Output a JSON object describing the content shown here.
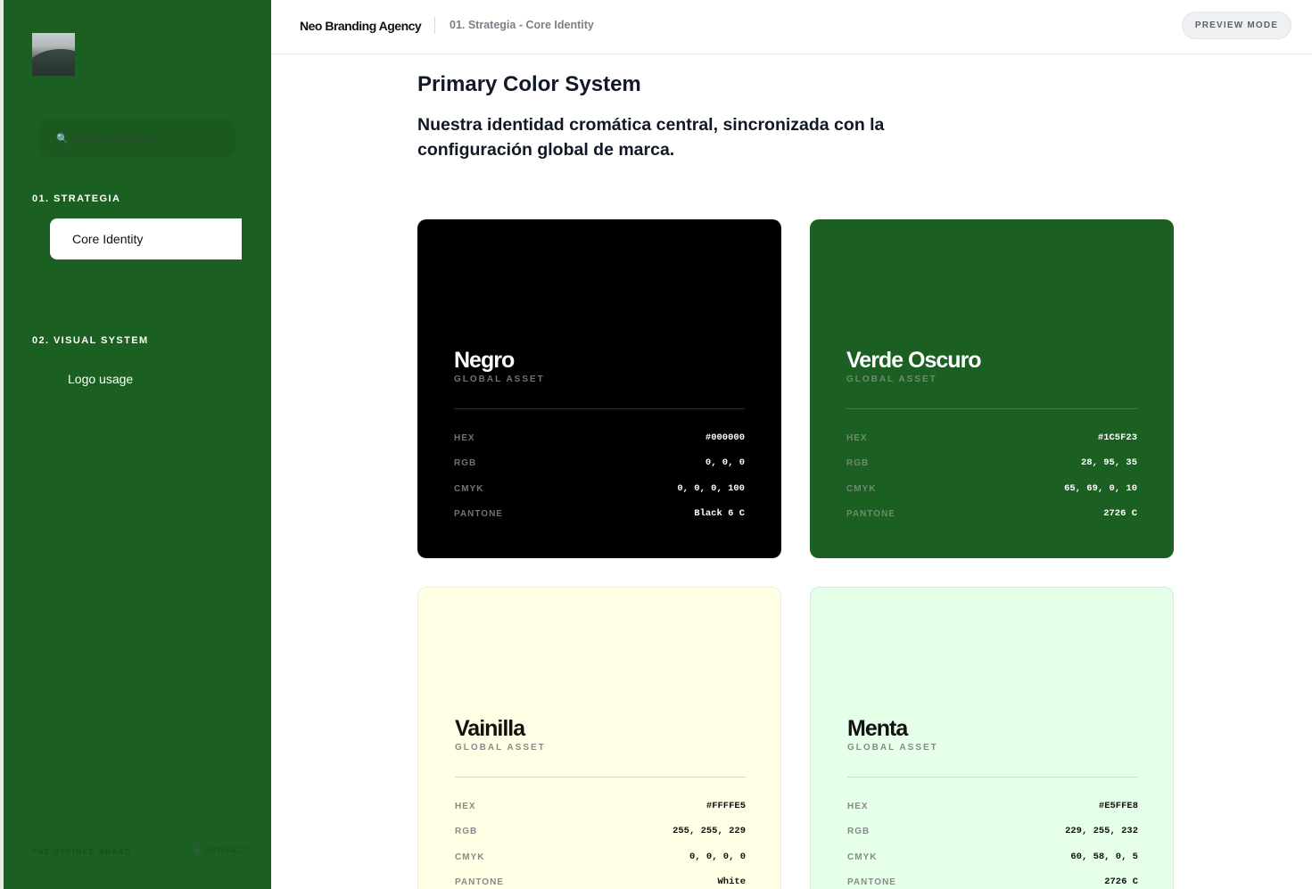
{
  "sidebar": {
    "search_placeholder": "Buscar sección...",
    "sections": [
      {
        "title": "01. STRATEGIA",
        "items": [
          "Core Identity"
        ]
      },
      {
        "title": "02. VISUAL SYSTEM",
        "items": [
          "Logo usage"
        ]
      }
    ],
    "footer_left": "THE DEFINED BRAND",
    "footer_right": "ARTEFACT"
  },
  "header": {
    "brand": "Neo Branding Agency",
    "breadcrumb": "01. Strategia - Core Identity",
    "preview_button": "PREVIEW MODE"
  },
  "main": {
    "title": "Primary Color System",
    "description": "Nuestra identidad cromática central, sincronizada con la configuración global de marca.",
    "labels": {
      "hex": "HEX",
      "rgb": "RGB",
      "cmyk": "CMYK",
      "pantone": "PANTONE",
      "asset": "GLOBAL ASSET"
    },
    "colors": [
      {
        "name": "Negro",
        "hex": "#000000",
        "rgb": "0, 0, 0",
        "cmyk": "0, 0, 0, 100",
        "pantone": "Black 6 C",
        "swatch": "#000000"
      },
      {
        "name": "Verde Oscuro",
        "hex": "#1C5F23",
        "rgb": "28, 95, 35",
        "cmyk": "65, 69, 0, 10",
        "pantone": "2726 C",
        "swatch": "#1C5F23"
      },
      {
        "name": "Vainilla",
        "hex": "#FFFFE5",
        "rgb": "255, 255, 229",
        "cmyk": "0, 0, 0, 0",
        "pantone": "White",
        "swatch": "#FFFFE5"
      },
      {
        "name": "Menta",
        "hex": "#E5FFE8",
        "rgb": "229, 255, 232",
        "cmyk": "60, 58, 0, 5",
        "pantone": "2726 C",
        "swatch": "#E5FFE8"
      }
    ]
  }
}
